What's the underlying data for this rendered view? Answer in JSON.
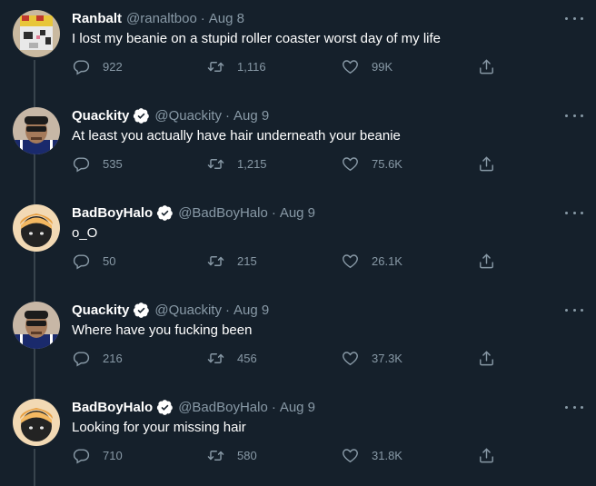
{
  "tweets": [
    {
      "name": "Ranbalt",
      "handle": "@ranaltboo",
      "date": "Aug 8",
      "verified": false,
      "text": "I lost my beanie on a stupid roller coaster worst day of my life",
      "replies": "922",
      "retweets": "1,116",
      "likes": "99K",
      "avatar": "pixel-block"
    },
    {
      "name": "Quackity",
      "handle": "@Quackity",
      "date": "Aug 9",
      "verified": true,
      "text": "At least you actually have hair underneath your beanie",
      "replies": "535",
      "retweets": "1,215",
      "likes": "75.6K",
      "avatar": "quackity"
    },
    {
      "name": "BadBoyHalo",
      "handle": "@BadBoyHalo",
      "date": "Aug 9",
      "verified": true,
      "text": "o_O",
      "replies": "50",
      "retweets": "215",
      "likes": "26.1K",
      "avatar": "badboyhalo"
    },
    {
      "name": "Quackity",
      "handle": "@Quackity",
      "date": "Aug 9",
      "verified": true,
      "text": "Where have you fucking been",
      "replies": "216",
      "retweets": "456",
      "likes": "37.3K",
      "avatar": "quackity"
    },
    {
      "name": "BadBoyHalo",
      "handle": "@BadBoyHalo",
      "date": "Aug 9",
      "verified": true,
      "text": "Looking for your missing hair",
      "replies": "710",
      "retweets": "580",
      "likes": "31.8K",
      "avatar": "badboyhalo"
    }
  ],
  "separator": "·",
  "colors": {
    "background": "#15202b",
    "muted": "#8899a6",
    "verified": "#ffffff",
    "thread": "#38444d"
  }
}
